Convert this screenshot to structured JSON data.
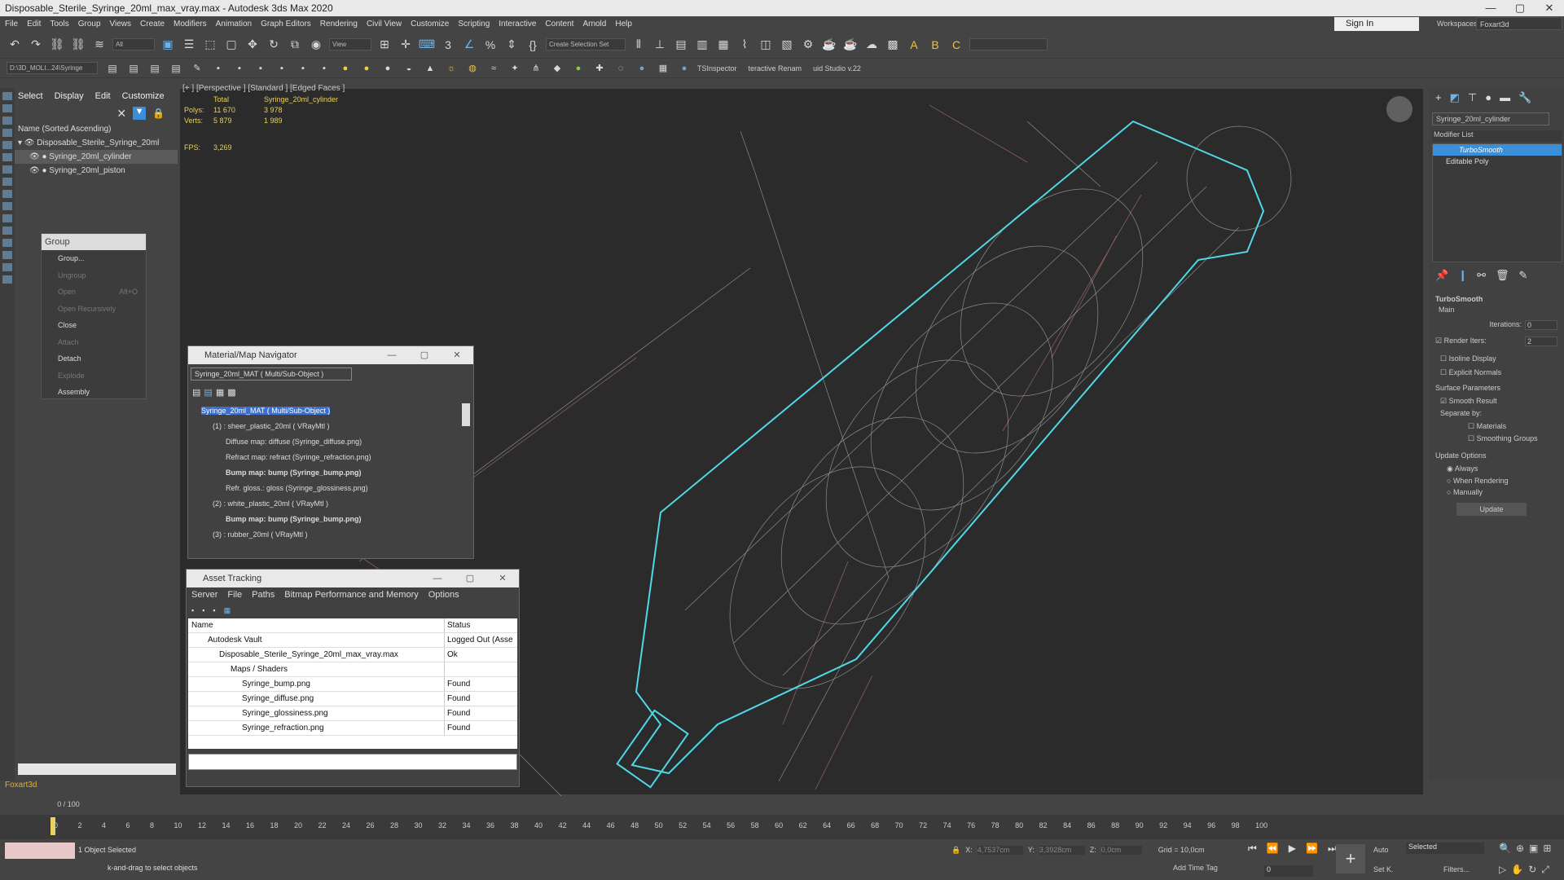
{
  "titlebar": {
    "title": "Disposable_Sterile_Syringe_20ml_max_vray.max - Autodesk 3ds Max 2020",
    "min": "—",
    "max": "▢",
    "close": "✕"
  },
  "menu": [
    "File",
    "Edit",
    "Tools",
    "Group",
    "Views",
    "Create",
    "Modifiers",
    "Animation",
    "Graph Editors",
    "Rendering",
    "Civil View",
    "Customize",
    "Scripting",
    "Interactive",
    "Content",
    "Arnold",
    "Help"
  ],
  "signin": "Sign In",
  "workspace": {
    "label": "Workspaces:",
    "value": "Foxart3d"
  },
  "toolbar1": {
    "filter": "All",
    "view": "View",
    "selection_set": "Create Selection Set"
  },
  "toolbar2": {
    "path": "D:\\3D_MOLI...24\\Syringe",
    "tsinspector": "TSInspector",
    "rename": "teractive Renam",
    "studio": "uid Studio v.22"
  },
  "explorer": {
    "tabs": [
      "Select",
      "Display",
      "Edit",
      "Customize"
    ],
    "header": "Name (Sorted Ascending)",
    "items": [
      "Disposable_Sterile_Syringe_20ml",
      "Syringe_20ml_cylinder",
      "Syringe_20ml_piston"
    ],
    "user": "Foxart3d",
    "frame": "0 / 100"
  },
  "group_panel": {
    "title": "Group",
    "items": [
      "Group...",
      "Ungroup",
      "Open",
      "Open Recursively",
      "Close",
      "Attach",
      "Detach",
      "Explode",
      "Assembly"
    ],
    "open_shortcut": "Alt+O"
  },
  "viewport": {
    "label": "[+ ] [Perspective ] [Standard ] [Edged Faces ]",
    "stats": {
      "total_lbl": "Total",
      "obj_lbl": "Syringe_20ml_cylinder",
      "polys_lbl": "Polys:",
      "polys_total": "11 670",
      "polys_obj": "3 978",
      "verts_lbl": "Verts:",
      "verts_total": "5 879",
      "verts_obj": "1 989",
      "fps_lbl": "FPS:",
      "fps": "3,269"
    }
  },
  "mat_nav": {
    "title": "Material/Map Navigator",
    "field": "Syringe_20ml_MAT  ( Multi/Sub-Object )",
    "rows": [
      "Syringe_20ml_MAT  ( Multi/Sub-Object )",
      "(1) : sheer_plastic_20ml  ( VRayMtl )",
      "Diffuse map: diffuse (Syringe_diffuse.png)",
      "Refract map: refract (Syringe_refraction.png)",
      "Bump map: bump (Syringe_bump.png)",
      "Refr. gloss.: gloss (Syringe_glossiness.png)",
      "(2) : white_plastic_20ml  ( VRayMtl )",
      "Bump map: bump (Syringe_bump.png)",
      "(3) : rubber_20ml  ( VRayMtl )"
    ]
  },
  "asset_tracking": {
    "title": "Asset Tracking",
    "menu": [
      "Server",
      "File",
      "Paths",
      "Bitmap Performance and Memory",
      "Options"
    ],
    "col_name": "Name",
    "col_status": "Status",
    "rows": [
      {
        "name": "Autodesk Vault",
        "status": "Logged Out (Asse"
      },
      {
        "name": "Disposable_Sterile_Syringe_20ml_max_vray.max",
        "status": "Ok"
      },
      {
        "name": "Maps / Shaders",
        "status": ""
      },
      {
        "name": "Syringe_bump.png",
        "status": "Found"
      },
      {
        "name": "Syringe_diffuse.png",
        "status": "Found"
      },
      {
        "name": "Syringe_glossiness.png",
        "status": "Found"
      },
      {
        "name": "Syringe_refraction.png",
        "status": "Found"
      }
    ]
  },
  "cmdpanel": {
    "object_name": "Syringe_20ml_cylinder",
    "modifier_list": "Modifier List",
    "stack": [
      "TurboSmooth",
      "Editable Poly"
    ],
    "rollout": "TurboSmooth",
    "main": "Main",
    "iterations_lbl": "Iterations:",
    "iterations": "0",
    "render_iters_lbl": "Render Iters:",
    "render_iters": "2",
    "isoline": "Isoline Display",
    "explicit": "Explicit Normals",
    "surface": "Surface Parameters",
    "smooth": "Smooth Result",
    "separate": "Separate by:",
    "materials": "Materials",
    "groups": "Smoothing Groups",
    "update_options": "Update Options",
    "always": "Always",
    "when_rendering": "When Rendering",
    "manually": "Manually",
    "update_btn": "Update"
  },
  "timeline": {
    "ticks": [
      "0",
      "2",
      "4",
      "6",
      "8",
      "10",
      "12",
      "14",
      "16",
      "18",
      "20",
      "22",
      "24",
      "26",
      "28",
      "30",
      "32",
      "34",
      "36",
      "38",
      "40",
      "42",
      "44",
      "46",
      "48",
      "50",
      "52",
      "54",
      "56",
      "58",
      "60",
      "62",
      "64",
      "66",
      "68",
      "70",
      "72",
      "74",
      "76",
      "78",
      "80",
      "82",
      "84",
      "86",
      "88",
      "90",
      "92",
      "94",
      "96",
      "98",
      "100"
    ]
  },
  "status": {
    "selected": "1 Object Selected",
    "hint": "k-and-drag to select objects",
    "x_lbl": "X:",
    "x": "4,7537cm",
    "y_lbl": "Y:",
    "y": "3,3928cm",
    "z_lbl": "Z:",
    "z": "0,0cm",
    "grid": "Grid = 10,0cm",
    "add_time_tag": "Add Time Tag",
    "auto": "Auto",
    "selected_dd": "Selected",
    "setk": "Set K.",
    "filters": "Filters...",
    "frame": "0"
  }
}
